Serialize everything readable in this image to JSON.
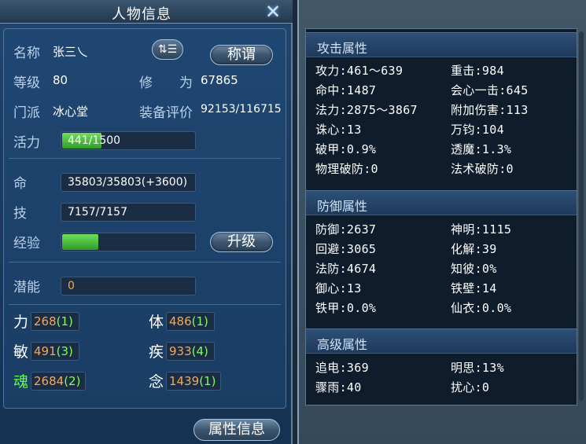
{
  "window_title": "人物信息",
  "profile": {
    "name_label": "名称",
    "name_value": "张三乀",
    "level_label": "等级",
    "level_value": "80",
    "cultivation_label": "修　　为",
    "cultivation_value": "67865",
    "sect_label": "门派",
    "sect_value": "冰心堂",
    "equip_label": "装备评价",
    "equip_value": "92153/116715",
    "title_button": "称谓",
    "vitality_label": "活力",
    "vitality_value": "441/1500",
    "vitality_fraction": 0.294
  },
  "vitals": {
    "hp_label": "命",
    "hp_value": "35803/35803(+3600)",
    "skill_label": "技",
    "skill_value": "7157/7157",
    "exp_label": "经验",
    "exp_fraction": 0.27,
    "upgrade_button": "升级",
    "potential_label": "潜能",
    "potential_value": "0"
  },
  "attributes": [
    {
      "label": "力",
      "value": "268",
      "bonus": "(1)",
      "label_color": "#ffffff"
    },
    {
      "label": "体",
      "value": "486",
      "bonus": "(1)",
      "label_color": "#ffffff"
    },
    {
      "label": "敏",
      "value": "491",
      "bonus": "(3)",
      "label_color": "#ffffff"
    },
    {
      "label": "疾",
      "value": "933",
      "bonus": "(4)",
      "label_color": "#ffffff"
    },
    {
      "label": "魂",
      "value": "2684",
      "bonus": "(2)",
      "label_color": "#62ff4a"
    },
    {
      "label": "念",
      "value": "1439",
      "bonus": "(1)",
      "label_color": "#ffffff"
    }
  ],
  "attr_info_button": "属性信息",
  "attack": {
    "title": "攻击属性",
    "left": [
      "攻力:461～639",
      "命中:1487",
      "法力:2875～3867",
      "诛心:13",
      "破甲:0.9%",
      "物理破防:0"
    ],
    "right": [
      "重击:984",
      "会心一击:645",
      "附加伤害:113",
      "万钧:104",
      "透魔:1.3%",
      "法术破防:0"
    ]
  },
  "defense": {
    "title": "防御属性",
    "left": [
      "防御:2637",
      "回避:3065",
      "法防:4674",
      "御心:13",
      "铁甲:0.0%"
    ],
    "right": [
      "神明:1115",
      "化解:39",
      "知彼:0%",
      "铁壁:14",
      "仙衣:0.0%"
    ]
  },
  "advanced": {
    "title": "高级属性",
    "left": [
      "追电:369",
      "骤雨:40"
    ],
    "right": [
      "明思:13%",
      "扰心:0"
    ]
  }
}
